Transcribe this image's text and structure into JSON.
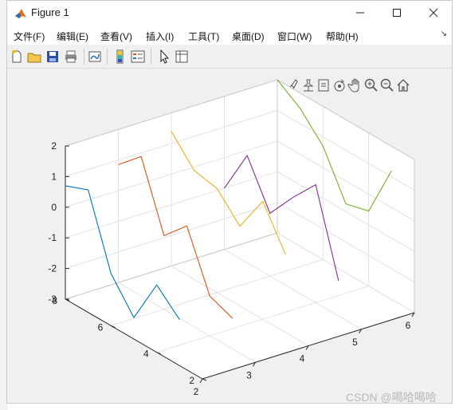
{
  "window": {
    "title": "Figure 1"
  },
  "menu": [
    {
      "label": "文件(F)"
    },
    {
      "label": "编辑(E)"
    },
    {
      "label": "查看(V)"
    },
    {
      "label": "插入(I)"
    },
    {
      "label": "工具(T)"
    },
    {
      "label": "桌面(D)"
    },
    {
      "label": "窗口(W)"
    },
    {
      "label": "帮助(H)"
    }
  ],
  "toolbar": {
    "icons": [
      "new-figure-icon",
      "open-file-icon",
      "save-icon",
      "print-icon",
      "link-plot-icon",
      "insert-colorbar-icon",
      "insert-legend-icon",
      "edit-plot-icon",
      "property-inspector-icon"
    ]
  },
  "axes_toolbar": {
    "icons": [
      "brush-icon",
      "data-tips-icon",
      "export-icon",
      "rotate-3d-icon",
      "pan-icon",
      "zoom-in-icon",
      "zoom-out-icon",
      "home-icon"
    ]
  },
  "watermark": "CSDN @喝哈喝哈",
  "chart_data": {
    "type": "line",
    "dimensions": "3d",
    "title": "",
    "xlabel": "",
    "ylabel": "",
    "zlabel": "",
    "xlim": [
      2,
      6
    ],
    "ylim": [
      2,
      8
    ],
    "zlim": [
      -3,
      2
    ],
    "x_ticks": [
      "2",
      "3",
      "4",
      "5",
      "6"
    ],
    "y_ticks": [
      "2",
      "4",
      "6",
      "8"
    ],
    "z_ticks": [
      "-3",
      "-2",
      "-1",
      "0",
      "1",
      "2"
    ],
    "grid": true,
    "series": [
      {
        "color": "#0072BD",
        "x": [
          2,
          2,
          2,
          2,
          2,
          2
        ],
        "y": [
          8,
          7,
          6,
          5,
          4,
          3
        ],
        "z": [
          0.7,
          1.0,
          -1.3,
          -2.3,
          -0.8,
          -1.5
        ]
      },
      {
        "color": "#D95319",
        "x": [
          3,
          3,
          3,
          3,
          3,
          3
        ],
        "y": [
          8,
          7,
          6,
          5,
          4,
          3
        ],
        "z": [
          0.85,
          1.55,
          -0.6,
          0.15,
          -1.7,
          -2.0
        ]
      },
      {
        "color": "#EDB120",
        "x": [
          4,
          4,
          4,
          4,
          4,
          4
        ],
        "y": [
          8,
          7,
          6,
          5,
          4,
          3
        ],
        "z": [
          1.4,
          0.55,
          0.4,
          -0.4,
          0.85,
          -0.45
        ]
      },
      {
        "color": "#7E2F8E",
        "x": [
          5,
          5,
          5,
          5,
          5,
          5
        ],
        "y": [
          8,
          7,
          6,
          5,
          4,
          3
        ],
        "z": [
          -1.0,
          0.5,
          -0.95,
          0.0,
          0.85,
          -1.85
        ]
      },
      {
        "color": "#77AC30",
        "x": [
          6,
          6,
          6,
          6,
          6,
          6
        ],
        "y": [
          8,
          7,
          6,
          5,
          4,
          3
        ],
        "z": [
          2.0,
          1.5,
          0.7,
          -0.75,
          -0.55,
          1.2
        ]
      }
    ]
  }
}
